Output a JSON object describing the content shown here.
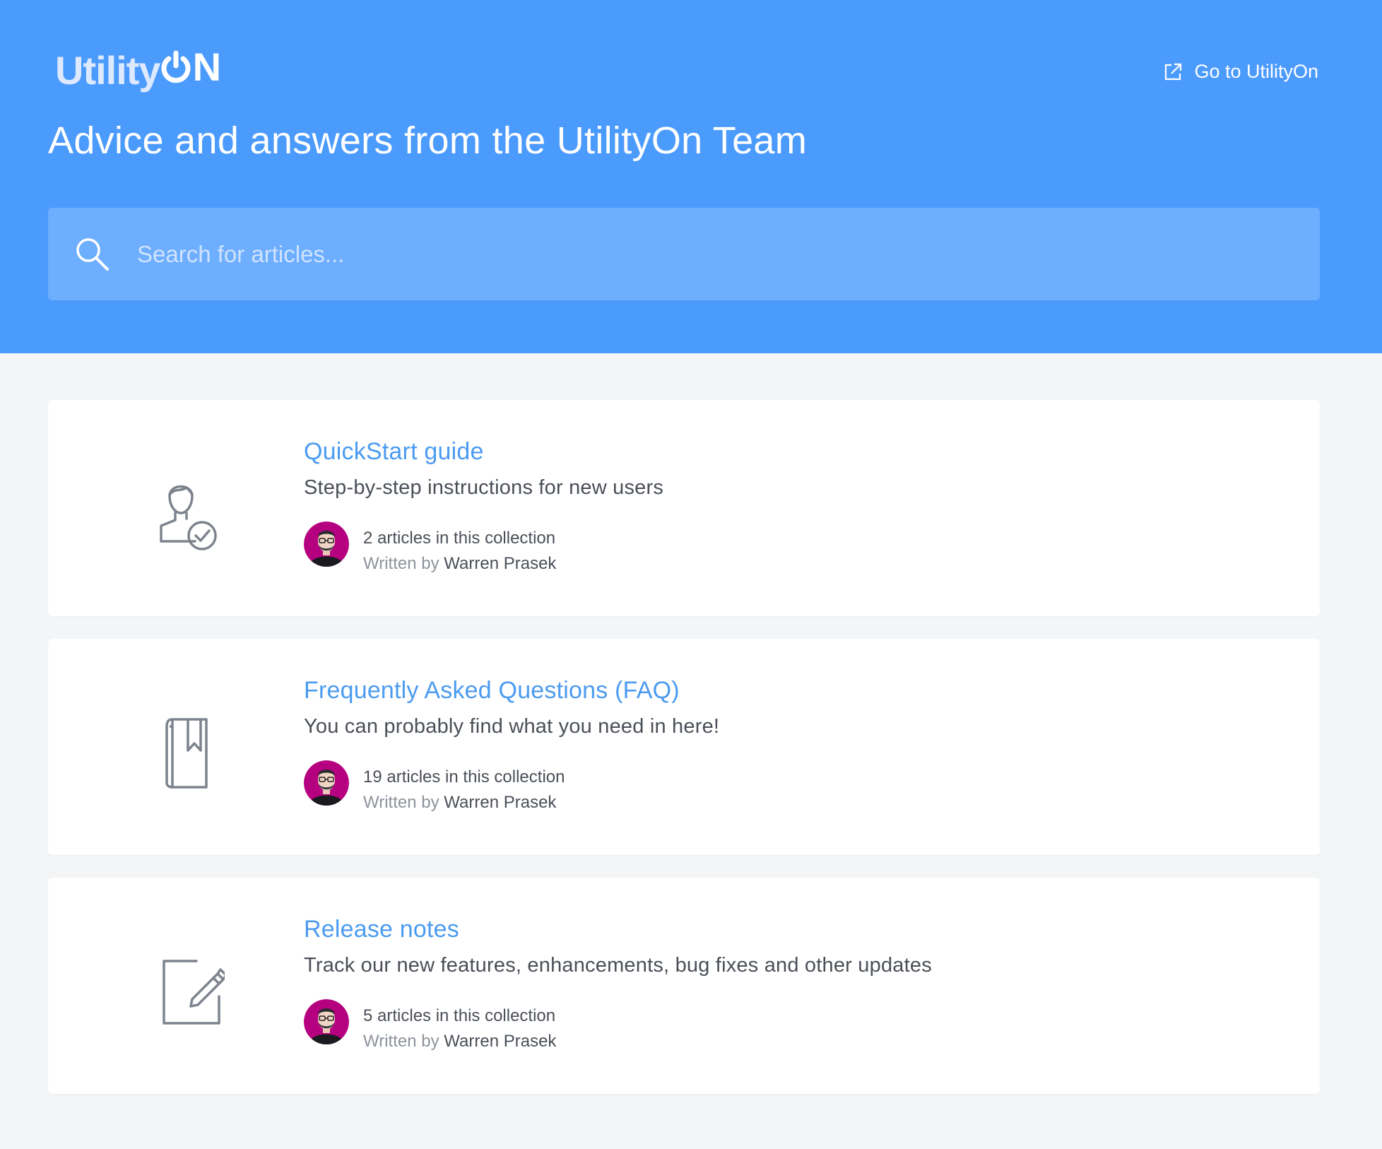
{
  "header": {
    "logo_text_a": "Utility",
    "logo_text_b": "N",
    "go_to_label": "Go to UtilityOn",
    "headline": "Advice and answers from the UtilityOn Team",
    "search_placeholder": "Search for articles..."
  },
  "collections": [
    {
      "icon": "user-check-icon",
      "title": "QuickStart guide",
      "description": "Step-by-step instructions for new users",
      "count": "2 articles in this collection",
      "written_by": "Written by",
      "author": "Warren Prasek"
    },
    {
      "icon": "bookmark-book-icon",
      "title": "Frequently Asked Questions (FAQ)",
      "description": "You can probably find what you need in here!",
      "count": "19 articles in this collection",
      "written_by": "Written by",
      "author": "Warren Prasek"
    },
    {
      "icon": "edit-note-icon",
      "title": "Release notes",
      "description": "Track our new features, enhancements, bug fixes and other updates",
      "count": "5 articles in this collection",
      "written_by": "Written by",
      "author": "Warren Prasek"
    }
  ],
  "colors": {
    "header_bg": "#4b9bfd",
    "search_bg": "#6eaefe",
    "link": "#4b9bf0",
    "page_bg": "#f3f5f7",
    "avatar_bg": "#b5007f"
  }
}
